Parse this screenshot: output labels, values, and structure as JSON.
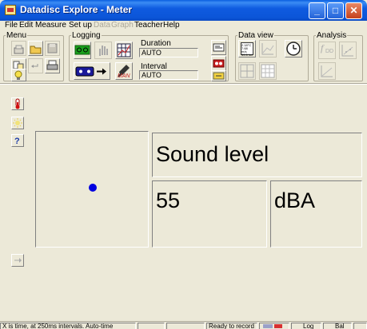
{
  "window": {
    "title": "Datadisc Explore - Meter",
    "minimize": "_",
    "maximize": "□",
    "close": "✕"
  },
  "menu": {
    "file": "File",
    "edit": "Edit",
    "measure": "Measure",
    "setup": "Set up",
    "data": "Data",
    "graph": "Graph",
    "teacher": "Teacher",
    "help": "Help"
  },
  "toolbar": {
    "menu_group": "Menu",
    "logging_group": "Logging",
    "data_view_group": "Data view",
    "analysis_group": "Analysis",
    "duration_label": "Duration",
    "duration_value": "AUTO",
    "interval_label": "Interval",
    "interval_value": "AUTO",
    "manual_label": "MAN",
    "table_thumb": "2.18°C 7.68 m/s 39.5 lux",
    "analysis_f": "f",
    "analysis_dd": "DD"
  },
  "meter": {
    "quantity": "Sound level",
    "value": "55",
    "unit": "dBA"
  },
  "status": {
    "info": "X is time, at 250ms intervals. Auto-time",
    "state": "Ready to record",
    "log": "Log",
    "bal": "Bal"
  },
  "colors": {
    "titlebar": "#0b55d8",
    "background": "#ece9d8",
    "dot": "#0000e0",
    "record_green": "#19a01c",
    "stop_red": "#c81e1e"
  },
  "icons": [
    "app-icon",
    "new-file-icon",
    "open-folder-icon",
    "save-icon",
    "copy-icon",
    "undo-icon",
    "print-icon",
    "tip-icon",
    "start-record-icon",
    "hand-icon",
    "snapshot-grid-icon",
    "tape-record-icon",
    "arrow-icon",
    "manual-probe-icon",
    "sensor-icon",
    "record-mode-icon",
    "playback-icon",
    "table-view-icon",
    "graph-view-icon",
    "clock-icon",
    "grid-view-icon",
    "table-grid-icon",
    "function-icon",
    "scatter-icon",
    "trend-icon",
    "thermometer-icon",
    "light-icon",
    "help-icon",
    "next-icon"
  ]
}
